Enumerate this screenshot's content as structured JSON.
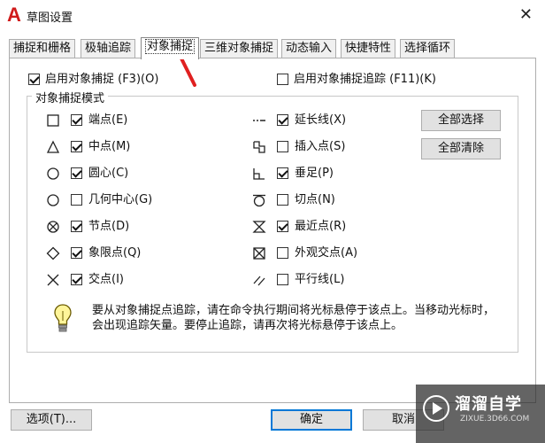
{
  "window": {
    "app_logo": "A",
    "title": "草图设置",
    "close_symbol": "✕"
  },
  "tabs": [
    {
      "label": "捕捉和栅格"
    },
    {
      "label": "极轴追踪"
    },
    {
      "label": "对象捕捉"
    },
    {
      "label": "三维对象捕捉"
    },
    {
      "label": "动态输入"
    },
    {
      "label": "快捷特性"
    },
    {
      "label": "选择循环"
    }
  ],
  "active_tab": "对象捕捉",
  "options": {
    "enable_snap": {
      "label": "启用对象捕捉 (F3)(O)",
      "checked": true
    },
    "enable_tracking": {
      "label": "启用对象捕捉追踪 (F11)(K)",
      "checked": false
    }
  },
  "group_title": "对象捕捉模式",
  "snap_modes_left": [
    {
      "label": "端点(E)",
      "checked": true,
      "symbol": "square-icon"
    },
    {
      "label": "中点(M)",
      "checked": true,
      "symbol": "triangle-icon"
    },
    {
      "label": "圆心(C)",
      "checked": true,
      "symbol": "circle-icon"
    },
    {
      "label": "几何中心(G)",
      "checked": false,
      "symbol": "circle-icon"
    },
    {
      "label": "节点(D)",
      "checked": true,
      "symbol": "node-icon"
    },
    {
      "label": "象限点(Q)",
      "checked": true,
      "symbol": "diamond-icon"
    },
    {
      "label": "交点(I)",
      "checked": true,
      "symbol": "x-icon"
    }
  ],
  "snap_modes_right": [
    {
      "label": "延长线(X)",
      "checked": true,
      "symbol": "extension-icon"
    },
    {
      "label": "插入点(S)",
      "checked": false,
      "symbol": "insertion-icon"
    },
    {
      "label": "垂足(P)",
      "checked": true,
      "symbol": "perpendicular-icon"
    },
    {
      "label": "切点(N)",
      "checked": false,
      "symbol": "tangent-icon"
    },
    {
      "label": "最近点(R)",
      "checked": true,
      "symbol": "nearest-icon"
    },
    {
      "label": "外观交点(A)",
      "checked": false,
      "symbol": "apparent-intersection-icon"
    },
    {
      "label": "平行线(L)",
      "checked": false,
      "symbol": "parallel-icon"
    }
  ],
  "buttons": {
    "select_all": "全部选择",
    "clear_all": "全部清除",
    "options": "选项(T)...",
    "ok": "确定",
    "cancel": "取消"
  },
  "hint": "要从对象捕捉点追踪，请在命令执行期间将光标悬停于该点上。当移动光标时，会出现追踪矢量。要停止追踪，请再次将光标悬停于该点上。",
  "watermark": {
    "text": "溜溜自学",
    "url": "ZIXUE.3D66.COM"
  },
  "colors": {
    "accent": "#0078d7",
    "logo_red": "#d01b1b",
    "annotation_arrow": "#e02020"
  }
}
